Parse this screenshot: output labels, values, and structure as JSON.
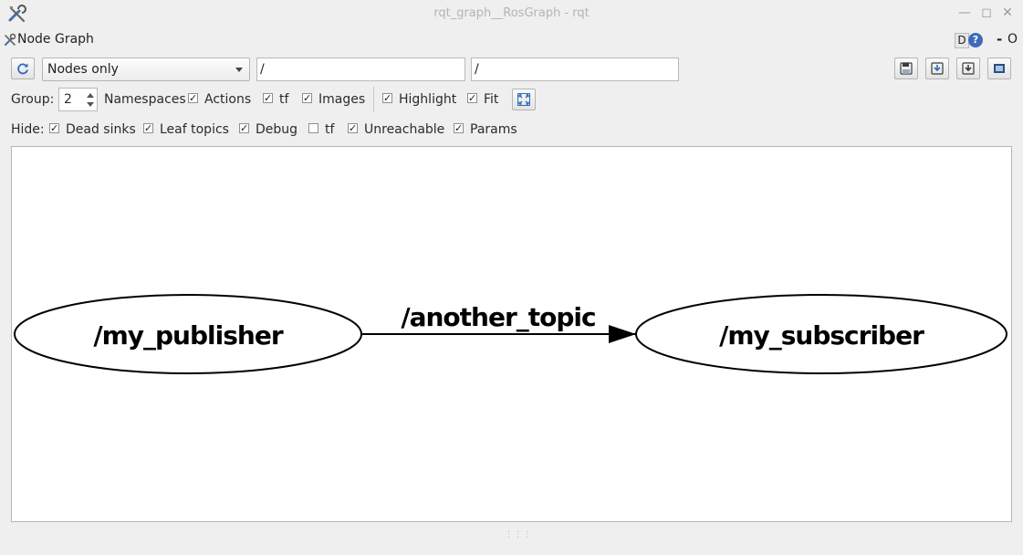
{
  "window": {
    "title": "rqt_graph__RosGraph - rqt",
    "app_icon": "tools-icon",
    "controls": [
      "minimize-icon",
      "maximize-icon",
      "close-icon"
    ]
  },
  "dock": {
    "title": "Node Graph",
    "d_label": "D",
    "help_label": "?",
    "minimize_label": "-",
    "close_label": "O"
  },
  "toolbar1": {
    "refresh_icon": "refresh-icon",
    "mode_value": "Nodes only",
    "filter1_value": "/",
    "filter2_value": "/",
    "right_buttons": [
      "load-dot-icon",
      "save-dot-icon",
      "save-svg-icon",
      "save-image-icon"
    ]
  },
  "toolbar2": {
    "group_label": "Group:",
    "group_value": "2",
    "namespaces_label": "Namespaces",
    "checks": [
      {
        "label": "Namespaces",
        "checked": true
      },
      {
        "label": "Actions",
        "checked": true
      },
      {
        "label": "tf",
        "checked": true
      },
      {
        "label": "Images",
        "checked": true
      },
      {
        "label": "Highlight",
        "checked": true
      },
      {
        "label": "Fit",
        "checked": true
      }
    ],
    "fit_icon": "fit-in-view-icon"
  },
  "toolbar3": {
    "hide_label": "Hide:",
    "checks": [
      {
        "label": "Dead sinks",
        "checked": true
      },
      {
        "label": "Leaf topics",
        "checked": true
      },
      {
        "label": "Debug",
        "checked": true
      },
      {
        "label": "tf",
        "checked": false
      },
      {
        "label": "Unreachable",
        "checked": true
      },
      {
        "label": "Params",
        "checked": true
      }
    ]
  },
  "graph": {
    "nodes": [
      {
        "label": "/my_publisher"
      },
      {
        "label": "/my_subscriber"
      }
    ],
    "edges": [
      {
        "label": "/another_topic",
        "from": "/my_publisher",
        "to": "/my_subscriber"
      }
    ]
  },
  "colors": {
    "background": "#efefef",
    "canvas": "#ffffff",
    "help_accent": "#3d6bb8"
  }
}
